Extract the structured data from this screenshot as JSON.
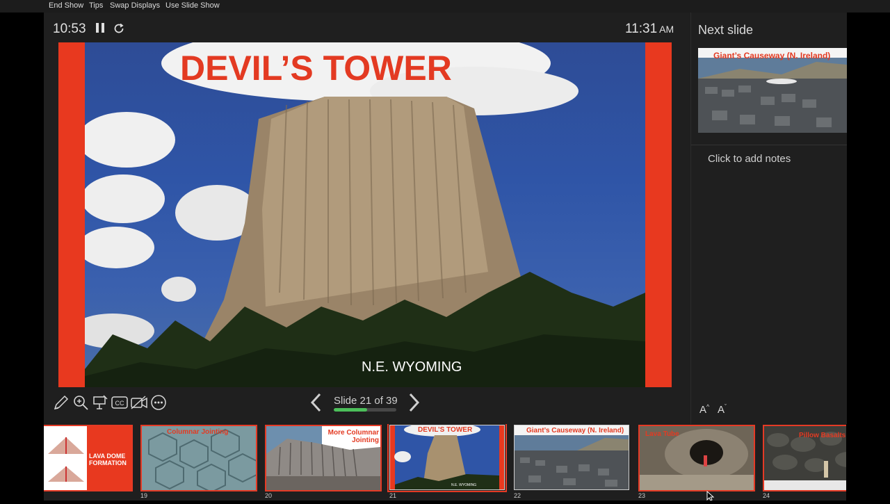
{
  "menubar": {
    "end_show": "End Show",
    "tips": "Tips",
    "swap_displays": "Swap Displays",
    "use_slide_show": "Use Slide Show"
  },
  "timer": {
    "elapsed": "10:53"
  },
  "clock": {
    "time": "11:31",
    "ampm": "AM"
  },
  "current_slide": {
    "title": "DEVIL’S TOWER",
    "caption": "N.E. WYOMING"
  },
  "navigation": {
    "counter": "Slide 21 of 39",
    "progress": 0.538
  },
  "next_slide": {
    "label": "Next slide",
    "title": "Giant’s Causeway (N. Ireland)"
  },
  "notes": {
    "placeholder": "Click to add notes"
  },
  "font_controls": {
    "grow": "A",
    "shrink": "A"
  },
  "filmstrip": {
    "thumbs": [
      {
        "num": "",
        "title": "LAVA DOME FORMATION"
      },
      {
        "num": "19",
        "title": "Columnar Jointing"
      },
      {
        "num": "20",
        "title": "More Columnar Jointing"
      },
      {
        "num": "21",
        "title": "DEVIL’S TOWER",
        "caption": "N.E. WYOMING"
      },
      {
        "num": "22",
        "title": "Giant’s Causeway (N. Ireland)"
      },
      {
        "num": "23",
        "title": "Lava Tube"
      },
      {
        "num": "24",
        "title": "Pillow Basalts"
      }
    ]
  },
  "colors": {
    "slide_red": "#e8391f",
    "title_red": "#e33a22",
    "progress_green": "#4cbf5a",
    "sky_blue": "#2f55a7"
  }
}
